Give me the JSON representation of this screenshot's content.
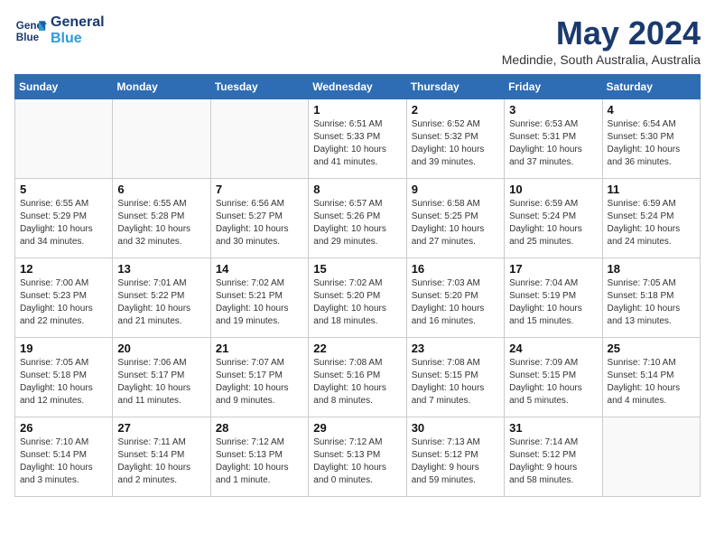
{
  "header": {
    "logo_line1": "General",
    "logo_line2": "Blue",
    "month": "May 2024",
    "location": "Medindie, South Australia, Australia"
  },
  "days_of_week": [
    "Sunday",
    "Monday",
    "Tuesday",
    "Wednesday",
    "Thursday",
    "Friday",
    "Saturday"
  ],
  "weeks": [
    [
      {
        "num": "",
        "info": ""
      },
      {
        "num": "",
        "info": ""
      },
      {
        "num": "",
        "info": ""
      },
      {
        "num": "1",
        "info": "Sunrise: 6:51 AM\nSunset: 5:33 PM\nDaylight: 10 hours\nand 41 minutes."
      },
      {
        "num": "2",
        "info": "Sunrise: 6:52 AM\nSunset: 5:32 PM\nDaylight: 10 hours\nand 39 minutes."
      },
      {
        "num": "3",
        "info": "Sunrise: 6:53 AM\nSunset: 5:31 PM\nDaylight: 10 hours\nand 37 minutes."
      },
      {
        "num": "4",
        "info": "Sunrise: 6:54 AM\nSunset: 5:30 PM\nDaylight: 10 hours\nand 36 minutes."
      }
    ],
    [
      {
        "num": "5",
        "info": "Sunrise: 6:55 AM\nSunset: 5:29 PM\nDaylight: 10 hours\nand 34 minutes."
      },
      {
        "num": "6",
        "info": "Sunrise: 6:55 AM\nSunset: 5:28 PM\nDaylight: 10 hours\nand 32 minutes."
      },
      {
        "num": "7",
        "info": "Sunrise: 6:56 AM\nSunset: 5:27 PM\nDaylight: 10 hours\nand 30 minutes."
      },
      {
        "num": "8",
        "info": "Sunrise: 6:57 AM\nSunset: 5:26 PM\nDaylight: 10 hours\nand 29 minutes."
      },
      {
        "num": "9",
        "info": "Sunrise: 6:58 AM\nSunset: 5:25 PM\nDaylight: 10 hours\nand 27 minutes."
      },
      {
        "num": "10",
        "info": "Sunrise: 6:59 AM\nSunset: 5:24 PM\nDaylight: 10 hours\nand 25 minutes."
      },
      {
        "num": "11",
        "info": "Sunrise: 6:59 AM\nSunset: 5:24 PM\nDaylight: 10 hours\nand 24 minutes."
      }
    ],
    [
      {
        "num": "12",
        "info": "Sunrise: 7:00 AM\nSunset: 5:23 PM\nDaylight: 10 hours\nand 22 minutes."
      },
      {
        "num": "13",
        "info": "Sunrise: 7:01 AM\nSunset: 5:22 PM\nDaylight: 10 hours\nand 21 minutes."
      },
      {
        "num": "14",
        "info": "Sunrise: 7:02 AM\nSunset: 5:21 PM\nDaylight: 10 hours\nand 19 minutes."
      },
      {
        "num": "15",
        "info": "Sunrise: 7:02 AM\nSunset: 5:20 PM\nDaylight: 10 hours\nand 18 minutes."
      },
      {
        "num": "16",
        "info": "Sunrise: 7:03 AM\nSunset: 5:20 PM\nDaylight: 10 hours\nand 16 minutes."
      },
      {
        "num": "17",
        "info": "Sunrise: 7:04 AM\nSunset: 5:19 PM\nDaylight: 10 hours\nand 15 minutes."
      },
      {
        "num": "18",
        "info": "Sunrise: 7:05 AM\nSunset: 5:18 PM\nDaylight: 10 hours\nand 13 minutes."
      }
    ],
    [
      {
        "num": "19",
        "info": "Sunrise: 7:05 AM\nSunset: 5:18 PM\nDaylight: 10 hours\nand 12 minutes."
      },
      {
        "num": "20",
        "info": "Sunrise: 7:06 AM\nSunset: 5:17 PM\nDaylight: 10 hours\nand 11 minutes."
      },
      {
        "num": "21",
        "info": "Sunrise: 7:07 AM\nSunset: 5:17 PM\nDaylight: 10 hours\nand 9 minutes."
      },
      {
        "num": "22",
        "info": "Sunrise: 7:08 AM\nSunset: 5:16 PM\nDaylight: 10 hours\nand 8 minutes."
      },
      {
        "num": "23",
        "info": "Sunrise: 7:08 AM\nSunset: 5:15 PM\nDaylight: 10 hours\nand 7 minutes."
      },
      {
        "num": "24",
        "info": "Sunrise: 7:09 AM\nSunset: 5:15 PM\nDaylight: 10 hours\nand 5 minutes."
      },
      {
        "num": "25",
        "info": "Sunrise: 7:10 AM\nSunset: 5:14 PM\nDaylight: 10 hours\nand 4 minutes."
      }
    ],
    [
      {
        "num": "26",
        "info": "Sunrise: 7:10 AM\nSunset: 5:14 PM\nDaylight: 10 hours\nand 3 minutes."
      },
      {
        "num": "27",
        "info": "Sunrise: 7:11 AM\nSunset: 5:14 PM\nDaylight: 10 hours\nand 2 minutes."
      },
      {
        "num": "28",
        "info": "Sunrise: 7:12 AM\nSunset: 5:13 PM\nDaylight: 10 hours\nand 1 minute."
      },
      {
        "num": "29",
        "info": "Sunrise: 7:12 AM\nSunset: 5:13 PM\nDaylight: 10 hours\nand 0 minutes."
      },
      {
        "num": "30",
        "info": "Sunrise: 7:13 AM\nSunset: 5:12 PM\nDaylight: 9 hours\nand 59 minutes."
      },
      {
        "num": "31",
        "info": "Sunrise: 7:14 AM\nSunset: 5:12 PM\nDaylight: 9 hours\nand 58 minutes."
      },
      {
        "num": "",
        "info": ""
      }
    ]
  ]
}
